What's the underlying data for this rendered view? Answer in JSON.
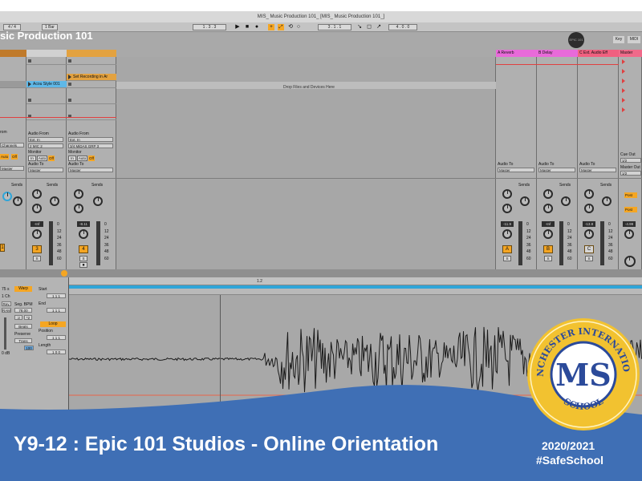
{
  "window": {
    "title": "MIS_ Music Production 101_ [MIS_ Music Production 101_]",
    "overlay_title": "sic Production 101"
  },
  "transport": {
    "meter_left": "4 / 4",
    "quantize": "1 Bar",
    "position_a": "1 . 3 . 3",
    "position_b": "3 . 1 . 1",
    "position_c": "4 . 0 . 0",
    "badge": "EPIC 101",
    "key_label": "Key",
    "midi_label": "MIDI"
  },
  "session": {
    "drop_hint": "Drop Files and Devices Here",
    "clips": {
      "acoustic": "Acou Style 001",
      "recording": "Set Recording in Ar"
    },
    "returns": [
      {
        "name": "A Reverb",
        "letter": "A",
        "volume": "-11.9",
        "color": "#e86ad9"
      },
      {
        "name": "B Delay",
        "letter": "B",
        "volume": "-Inf",
        "color": "#e86ad9"
      },
      {
        "name": "C Ext. Audio Eff",
        "letter": "C",
        "volume": "-13.8",
        "color": "#f06080"
      }
    ],
    "master": {
      "name": "Master",
      "volume": "-4.99",
      "cue_out": "Cue Out",
      "cue_value": "1/2",
      "master_out": "Master Out",
      "master_value": "1/2",
      "color": "#f06a8a"
    },
    "tracks": [
      {
        "audio_from": "Audio From",
        "from_value": "Ext. In",
        "channels": "Channels",
        "monitor": "Monitor",
        "in": "In",
        "auto": "Auto",
        "off": "Off",
        "audio_to": "Audio To",
        "to_value": "Master",
        "number": "1",
        "volume": "-Inf"
      },
      {
        "audio_from": "Audio From",
        "from_value": "Ext. In",
        "channels": "2 MIC 2",
        "monitor": "Monitor",
        "in": "In",
        "auto": "Auto",
        "off": "Off",
        "audio_to": "Audio To",
        "to_value": "Master",
        "number": "3",
        "volume": "-Inf"
      },
      {
        "audio_from": "Audio From",
        "from_value": "Ext. In",
        "channels": "3/4 MiDAS GRP 3",
        "monitor": "Monitor",
        "in": "In",
        "auto": "Auto",
        "off": "Off",
        "audio_to": "Audio To",
        "to_value": "Master",
        "number": "4",
        "volume": "-8.11"
      }
    ],
    "sends_label": "Sends",
    "scale": [
      "0",
      "12",
      "24",
      "36",
      "48",
      "60"
    ],
    "post_label": "Post",
    "solo_label": "S"
  },
  "clip": {
    "warp": "Warp",
    "start": "Start",
    "end": "End",
    "seg_bpm": "Seg. BPM",
    "bpm_value": "78.00",
    "loop": "Loop",
    "position": "Position",
    "length": "Length",
    "preserve": "Preserve",
    "preserve_value": "Trans",
    "beats": "Beats",
    "db": "0 dB",
    "rate": "Rev.",
    "ram": "RAM",
    "channels": "1 Ch",
    "gain": "100",
    "file_rate": "75 s",
    "ruler_mark": "1.2"
  },
  "banner": {
    "title": "Y9-12 : Epic 101 Studios - Online Orientation",
    "year": "2020/2021",
    "hashtag": "#SafeSchool",
    "seal_top": "MANCHESTER INTERNATIONAL",
    "seal_bottom": "SCHOOL",
    "seal_mono": "MS"
  },
  "colors": {
    "banner_blue": "#3f6fb5",
    "ableton_orange": "#f5a623",
    "loop_blue": "#2fa5d8",
    "seal_gold": "#f2c230",
    "seal_navy": "#2b4a9a"
  }
}
